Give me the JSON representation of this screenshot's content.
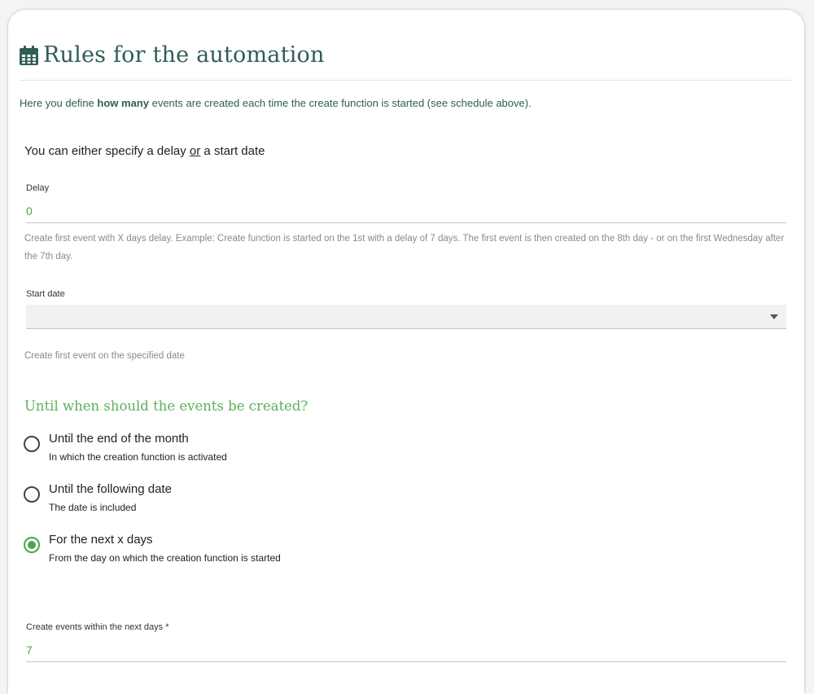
{
  "header": {
    "title": "Rules for the automation",
    "icon": "calendar-icon",
    "color": "#2e5d57"
  },
  "intro": {
    "before": "Here you define ",
    "bold": "how many",
    "after": " events are created each time the create function is started (see schedule above)."
  },
  "either": {
    "before": "You can either specify a delay ",
    "underlined": "or",
    "after": " a start date"
  },
  "delay": {
    "label": "Delay",
    "value": "0",
    "hint": "Create first event with X days delay. Example: Create function is started on the 1st with a delay of 7 days. The first event is then created on the 8th day - or on the first Wednesday after the 7th day."
  },
  "start_date": {
    "label": "Start date",
    "value": "",
    "hint": "Create first event on the specified date"
  },
  "until": {
    "title": "Until when should the events be created?",
    "options": [
      {
        "title": "Until the end of the month",
        "sub": "In which the creation function is activated",
        "selected": false
      },
      {
        "title": "Until the following date",
        "sub": "The date is included",
        "selected": false
      },
      {
        "title": "For the next x days",
        "sub": "From the day on which the creation function is started",
        "selected": true
      }
    ]
  },
  "next_days": {
    "label": "Create events within the next days *",
    "value": "7"
  },
  "colors": {
    "accent": "#4aa84a",
    "heading": "#2e5d57"
  }
}
